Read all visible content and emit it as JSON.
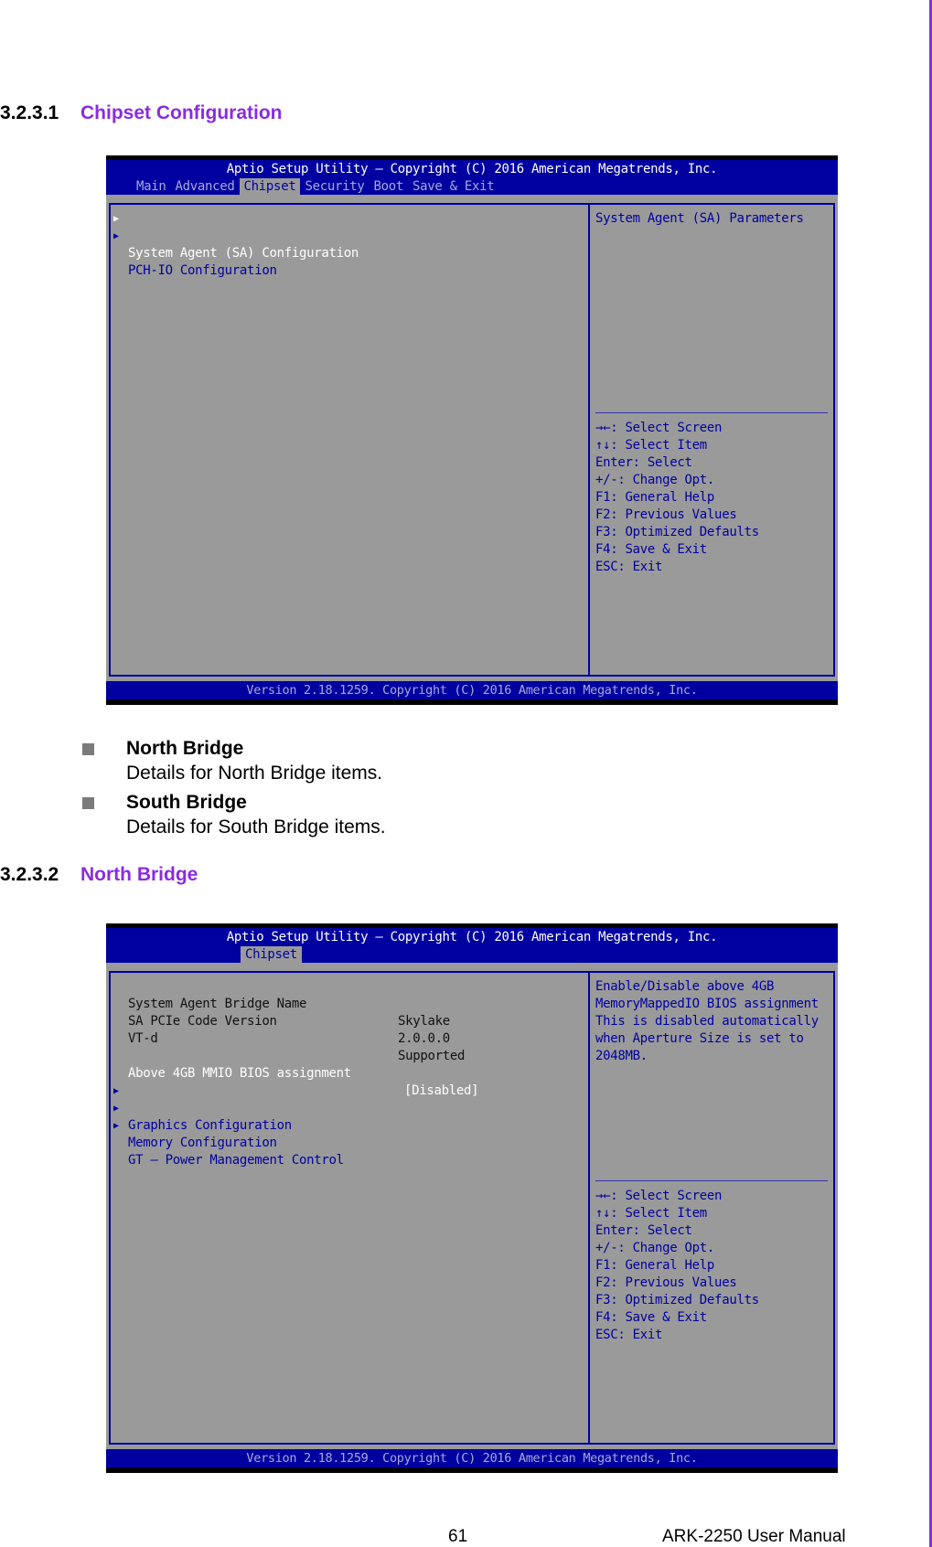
{
  "section1": {
    "number": "3.2.3.1",
    "title": "Chipset Configuration"
  },
  "bios1": {
    "title": "Aptio Setup Utility – Copyright (C) 2016 American Megatrends, Inc.",
    "tabs": [
      {
        "label": "Main",
        "active": false
      },
      {
        "label": "Advanced",
        "active": false
      },
      {
        "label": "Chipset",
        "active": true
      },
      {
        "label": "Security",
        "active": false
      },
      {
        "label": "Boot",
        "active": false
      },
      {
        "label": "Save & Exit",
        "active": false
      }
    ],
    "menu_items": [
      {
        "label": "System Agent (SA) Configuration",
        "selected": true
      },
      {
        "label": "PCH-IO Configuration",
        "selected": false
      }
    ],
    "help_text": [
      "System Agent (SA) Parameters"
    ],
    "keys": [
      "→←: Select Screen",
      "↑↓: Select Item",
      "Enter: Select",
      "+/-: Change Opt.",
      "F1: General Help",
      "F2: Previous Values",
      "F3: Optimized Defaults",
      "F4: Save & Exit",
      "ESC: Exit"
    ],
    "footer": "Version 2.18.1259. Copyright (C) 2016 American Megatrends, Inc."
  },
  "bullets": [
    {
      "title": "North Bridge",
      "desc": "Details for North Bridge items."
    },
    {
      "title": "South Bridge",
      "desc": "Details for South Bridge items."
    }
  ],
  "section2": {
    "number": "3.2.3.2",
    "title": "North Bridge"
  },
  "bios2": {
    "title": "Aptio Setup Utility – Copyright (C) 2016 American Megatrends, Inc.",
    "tabs": [
      {
        "label": "Chipset",
        "active": true
      }
    ],
    "info_rows": [
      {
        "label": "System Agent Bridge Name",
        "value": "Skylake"
      },
      {
        "label": "SA PCIe Code Version",
        "value": "2.0.0.0"
      },
      {
        "label": "VT-d",
        "value": "Supported"
      }
    ],
    "setting": {
      "label": "Above 4GB MMIO BIOS assignment",
      "value": "[Disabled]"
    },
    "menu_items": [
      {
        "label": "Graphics Configuration"
      },
      {
        "label": "Memory Configuration"
      },
      {
        "label": "GT – Power Management Control"
      }
    ],
    "help_text": [
      "Enable/Disable above 4GB",
      "MemoryMappedIO BIOS assignment",
      "This is disabled automatically",
      "when Aperture Size is set to",
      "2048MB."
    ],
    "keys": [
      "→←: Select Screen",
      "↑↓: Select Item",
      "Enter: Select",
      "+/-: Change Opt.",
      "F1: General Help",
      "F2: Previous Values",
      "F3: Optimized Defaults",
      "F4: Save & Exit",
      "ESC: Exit"
    ],
    "footer": "Version 2.18.1259. Copyright (C) 2016 American Megatrends, Inc."
  },
  "page_footer": {
    "page_number": "61",
    "manual_title": "ARK-2250 User Manual"
  },
  "colors": {
    "accent": "#8a2be2",
    "bios_blue": "#0000a0",
    "bios_grey": "#9a9a9a"
  }
}
